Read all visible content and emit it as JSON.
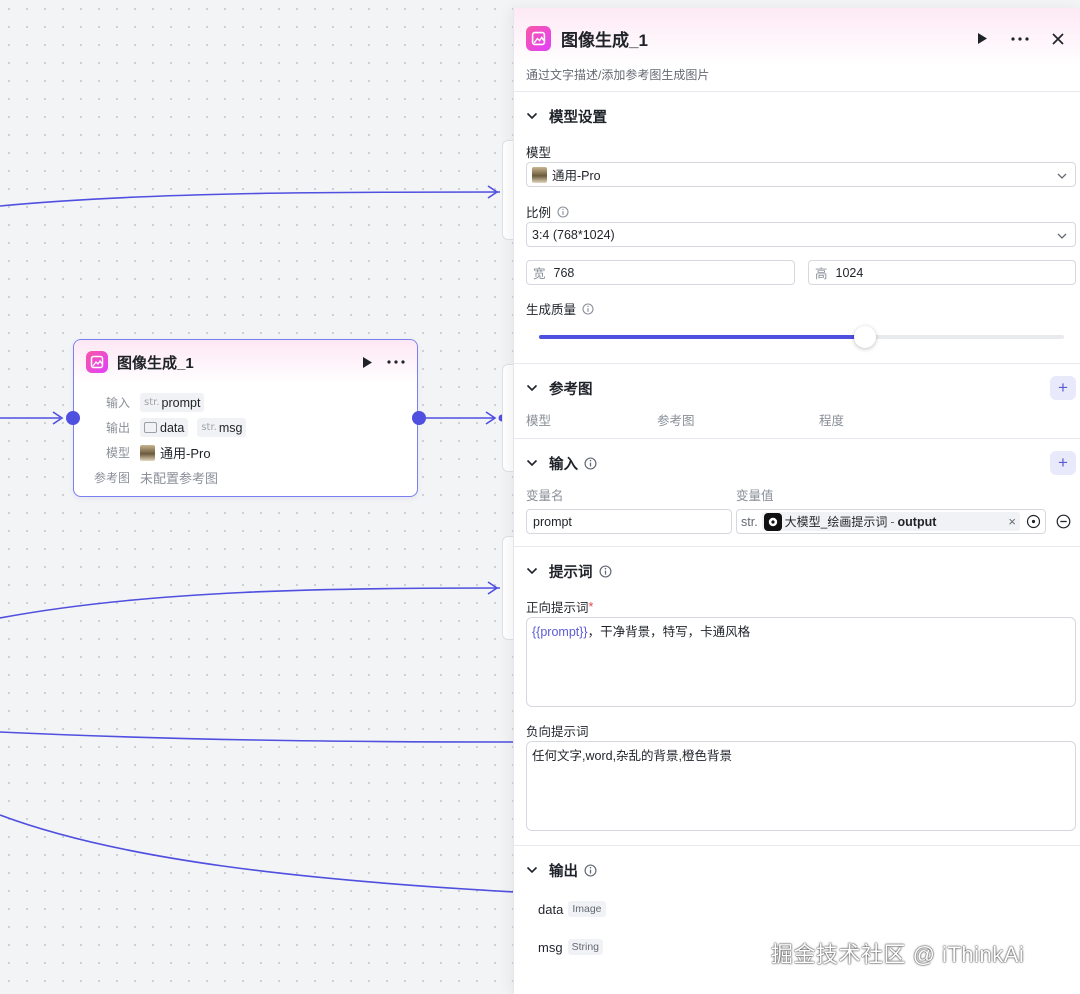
{
  "node": {
    "title": "图像生成_1",
    "input_label": "输入",
    "input_type": "str.",
    "input_value": "prompt",
    "output_label": "输出",
    "output_items": [
      {
        "type_icon": "image-icon",
        "name": "data"
      },
      {
        "type": "str.",
        "name": "msg"
      }
    ],
    "model_label": "模型",
    "model_value": "通用-Pro",
    "ref_label": "参考图",
    "ref_value": "未配置参考图"
  },
  "panel": {
    "title": "图像生成_1",
    "description": "通过文字描述/添加参考图生成图片",
    "model_settings": {
      "section_title": "模型设置",
      "model_label": "模型",
      "model_value": "通用-Pro",
      "ratio_label": "比例",
      "ratio_value": "3:4 (768*1024)",
      "width_label": "宽",
      "width_value": "768",
      "height_label": "高",
      "height_value": "1024",
      "quality_label": "生成质量",
      "quality_fraction": 0.62
    },
    "reference": {
      "section_title": "参考图",
      "columns": [
        "模型",
        "参考图",
        "程度"
      ]
    },
    "inputs": {
      "section_title": "输入",
      "col_name": "变量名",
      "col_value": "变量值",
      "var_name": "prompt",
      "var_type": "str.",
      "var_source": "大模型_绘画提示词",
      "var_sep": "-",
      "var_field": "output"
    },
    "prompt": {
      "section_title": "提示词",
      "positive_label": "正向提示词",
      "required_mark": "*",
      "positive_var": "{{prompt}}",
      "positive_text": "，干净背景，特写，卡通风格",
      "negative_label": "负向提示词",
      "negative_text": "任何文字,word,杂乱的背景,橙色背景"
    },
    "outputs": {
      "section_title": "输出",
      "items": [
        {
          "name": "data",
          "type": "Image"
        },
        {
          "name": "msg",
          "type": "String"
        }
      ]
    }
  },
  "watermark": "掘金技术社区 @ iThinkAi",
  "colors": {
    "accent": "#4f4fe0",
    "node_border": "#7b7ff0",
    "app_icon": "#f857a6",
    "header_tint": "#fde9f5"
  }
}
